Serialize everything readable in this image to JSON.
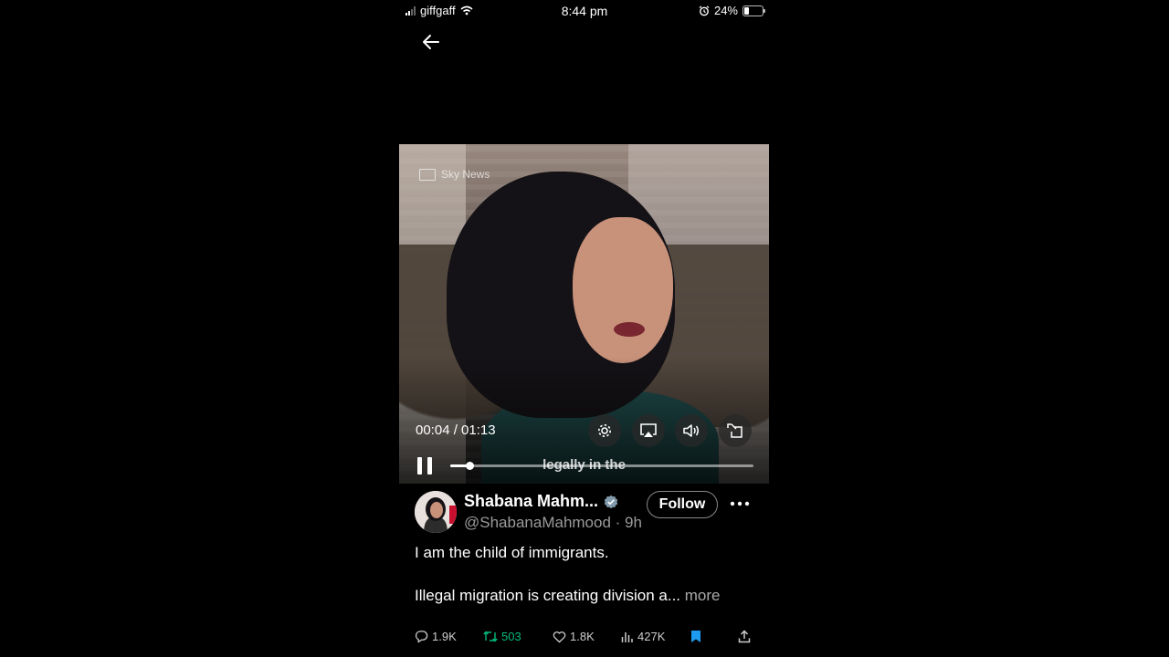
{
  "status_bar": {
    "carrier": "giffgaff",
    "time": "8:44 pm",
    "battery_percent": "24%",
    "battery_level": 0.24,
    "icons": [
      "signal-icon",
      "wifi-icon",
      "alarm-icon",
      "battery-icon"
    ]
  },
  "nav": {
    "back_icon": "arrow-left-icon"
  },
  "video": {
    "watermark": "Sky News",
    "time_display": "00:04 / 01:13",
    "progress_fraction": 0.065,
    "caption": "legally in the",
    "controls": [
      "settings-icon",
      "airplay-icon",
      "volume-icon",
      "expand-icon"
    ],
    "playback_icon": "pause-icon"
  },
  "post": {
    "display_name": "Shabana Mahm...",
    "verified": true,
    "handle": "@ShabanaMahmood",
    "time_ago": "9h",
    "follow_label": "Follow",
    "text_line_1": "I am the child of immigrants.",
    "text_line_2": "Illegal migration is creating division a...",
    "more_label": "more"
  },
  "actions": {
    "replies": "1.9K",
    "reposts": "503",
    "likes": "1.8K",
    "views": "427K",
    "colors": {
      "repost": "#00ba7c",
      "bookmark": "#1d9bf0"
    }
  }
}
